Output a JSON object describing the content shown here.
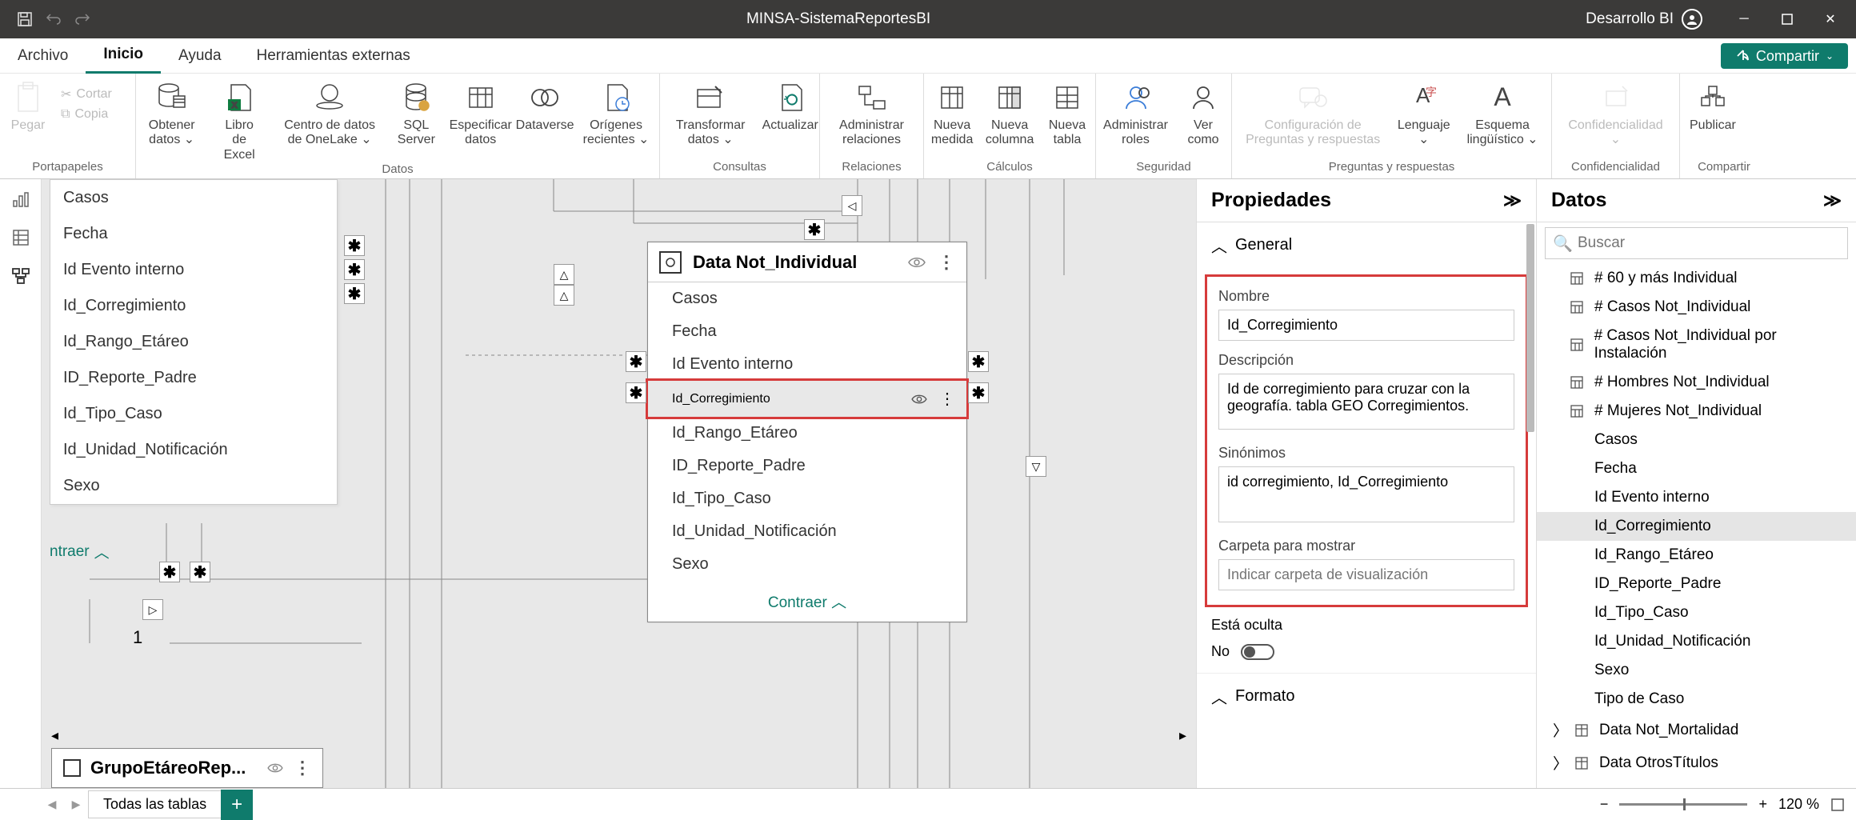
{
  "titlebar": {
    "title": "MINSA-SistemaReportesBI",
    "user": "Desarrollo BI"
  },
  "menu": {
    "archivo": "Archivo",
    "inicio": "Inicio",
    "ayuda": "Ayuda",
    "herramientas": "Herramientas externas",
    "compartir": "Compartir"
  },
  "ribbon": {
    "portapapeles": {
      "label": "Portapapeles",
      "pegar": "Pegar",
      "cortar": "Cortar",
      "copia": "Copia"
    },
    "datos": {
      "label": "Datos",
      "obtener": "Obtener datos",
      "libro": "Libro de Excel",
      "onelake": "Centro de datos de OneLake",
      "sql": "SQL Server",
      "especificar": "Especificar datos",
      "dataverse": "Dataverse",
      "origenes": "Orígenes recientes"
    },
    "consultas": {
      "label": "Consultas",
      "transformar": "Transformar datos",
      "actualizar": "Actualizar"
    },
    "relaciones": {
      "label": "Relaciones",
      "administrar": "Administrar relaciones"
    },
    "calculos": {
      "label": "Cálculos",
      "medida": "Nueva medida",
      "columna": "Nueva columna",
      "tabla": "Nueva tabla"
    },
    "seguridad": {
      "label": "Seguridad",
      "roles": "Administrar roles",
      "ver": "Ver como"
    },
    "preguntas": {
      "label": "Preguntas y respuestas",
      "config": "Configuración de Preguntas y respuestas",
      "lenguaje": "Lenguaje",
      "esquema": "Esquema lingüístico"
    },
    "confidencialidad": {
      "label": "Confidencialidad",
      "btn": "Confidencialidad"
    },
    "compartir": {
      "label": "Compartir",
      "publicar": "Publicar"
    }
  },
  "left_columns": {
    "items": [
      "Casos",
      "Fecha",
      "Id Evento interno",
      "Id_Corregimiento",
      "Id_Rango_Etáreo",
      "ID_Reporte_Padre",
      "Id_Tipo_Caso",
      "Id_Unidad_Notificación",
      "Sexo"
    ],
    "collapse": "ntraer"
  },
  "one_marker": "1",
  "table_card": {
    "title": "Data Not_Individual",
    "rows_before": [
      "Casos",
      "Fecha",
      "Id Evento interno"
    ],
    "selected": "Id_Corregimiento",
    "rows_after": [
      "Id_Rango_Etáreo",
      "ID_Reporte_Padre",
      "Id_Tipo_Caso",
      "Id_Unidad_Notificación",
      "Sexo"
    ],
    "collapse": "Contraer"
  },
  "grp_card": {
    "title": "GrupoEtáreoRep..."
  },
  "props": {
    "header": "Propiedades",
    "general": "General",
    "nombre_label": "Nombre",
    "nombre_value": "Id_Corregimiento",
    "desc_label": "Descripción",
    "desc_value": "Id de corregimiento para cruzar con la geografía. tabla GEO Corregimientos.",
    "syn_label": "Sinónimos",
    "syn_value": "id corregimiento, Id_Corregimiento",
    "folder_label": "Carpeta para mostrar",
    "folder_placeholder": "Indicar carpeta de visualización",
    "oculta_label": "Está oculta",
    "oculta_value": "No",
    "formato": "Formato"
  },
  "data": {
    "header": "Datos",
    "search_placeholder": "Buscar",
    "fields": [
      {
        "label": "# 60 y más Individual",
        "type": "calc"
      },
      {
        "label": "# Casos Not_Individual",
        "type": "calc"
      },
      {
        "label": "# Casos Not_Individual por Instalación",
        "type": "calc"
      },
      {
        "label": "# Hombres Not_Individual",
        "type": "calc"
      },
      {
        "label": "# Mujeres Not_Individual",
        "type": "calc"
      },
      {
        "label": "Casos",
        "type": "col"
      },
      {
        "label": "Fecha",
        "type": "col"
      },
      {
        "label": "Id Evento interno",
        "type": "col"
      },
      {
        "label": "Id_Corregimiento",
        "type": "col",
        "selected": true
      },
      {
        "label": "Id_Rango_Etáreo",
        "type": "col"
      },
      {
        "label": "ID_Reporte_Padre",
        "type": "col"
      },
      {
        "label": "Id_Tipo_Caso",
        "type": "col"
      },
      {
        "label": "Id_Unidad_Notificación",
        "type": "col"
      },
      {
        "label": "Sexo",
        "type": "col"
      },
      {
        "label": "Tipo de Caso",
        "type": "col"
      }
    ],
    "tables": [
      {
        "label": "Data Not_Mortalidad"
      },
      {
        "label": "Data OtrosTítulos"
      }
    ]
  },
  "footer": {
    "tab": "Todas las tablas",
    "zoom": "120 %"
  }
}
